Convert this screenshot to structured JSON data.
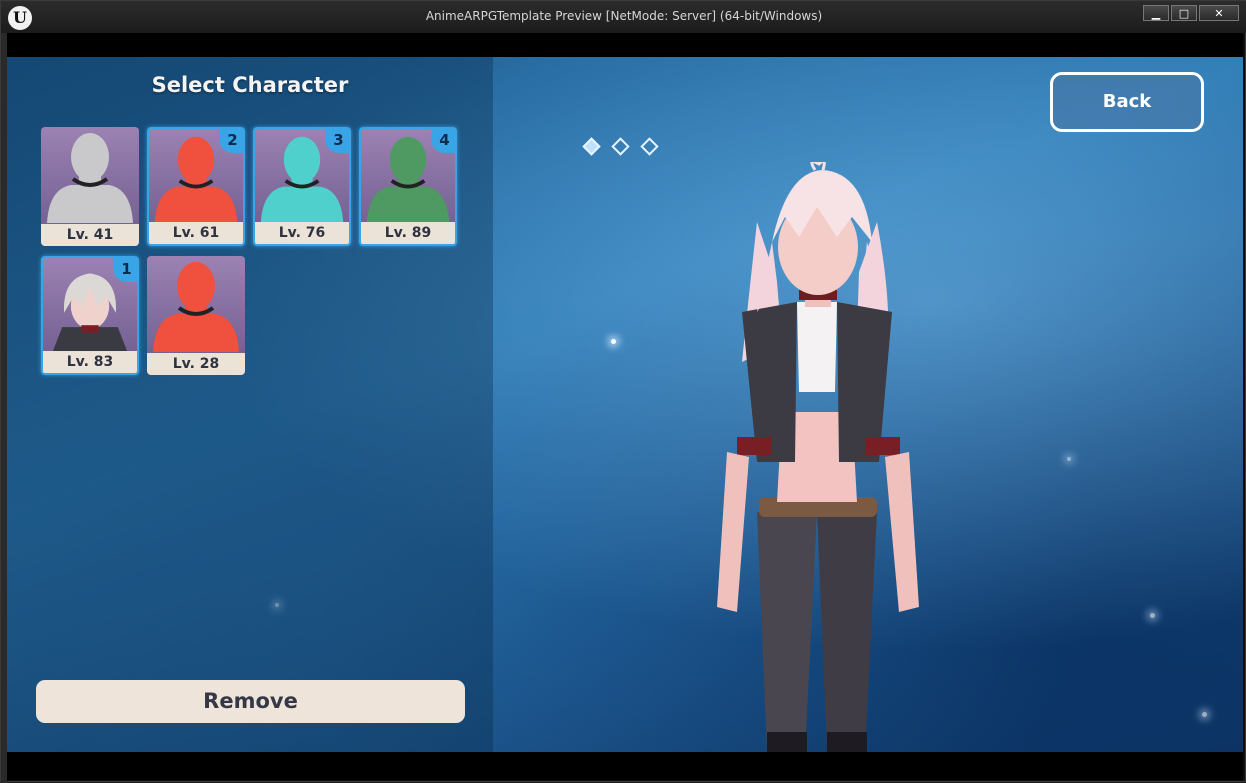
{
  "window": {
    "title": "AnimeARPGTemplate Preview [NetMode: Server]  (64-bit/Windows)",
    "logo": "U",
    "buttons": {
      "minimize": "▁",
      "maximize": "□",
      "close": "✕"
    }
  },
  "panel": {
    "title": "Select Character",
    "remove_label": "Remove"
  },
  "characters": [
    {
      "level": "Lv. 41",
      "color": "#c9c9cc",
      "badge": ""
    },
    {
      "level": "Lv. 61",
      "color": "#f0503e",
      "badge": "2"
    },
    {
      "level": "Lv. 76",
      "color": "#4fd0cc",
      "badge": "3"
    },
    {
      "level": "Lv. 89",
      "color": "#4e9a62",
      "badge": "4"
    },
    {
      "level": "Lv. 83",
      "color": "#d8d4d4",
      "badge": "1"
    },
    {
      "level": "Lv. 28",
      "color": "#f0503e",
      "badge": ""
    }
  ],
  "nav": {
    "back_label": "Back",
    "pages": 3,
    "active_page": 1
  },
  "colors": {
    "accent": "#3aa5e6",
    "button_bg": "#eee4d9",
    "button_text": "#343846"
  }
}
